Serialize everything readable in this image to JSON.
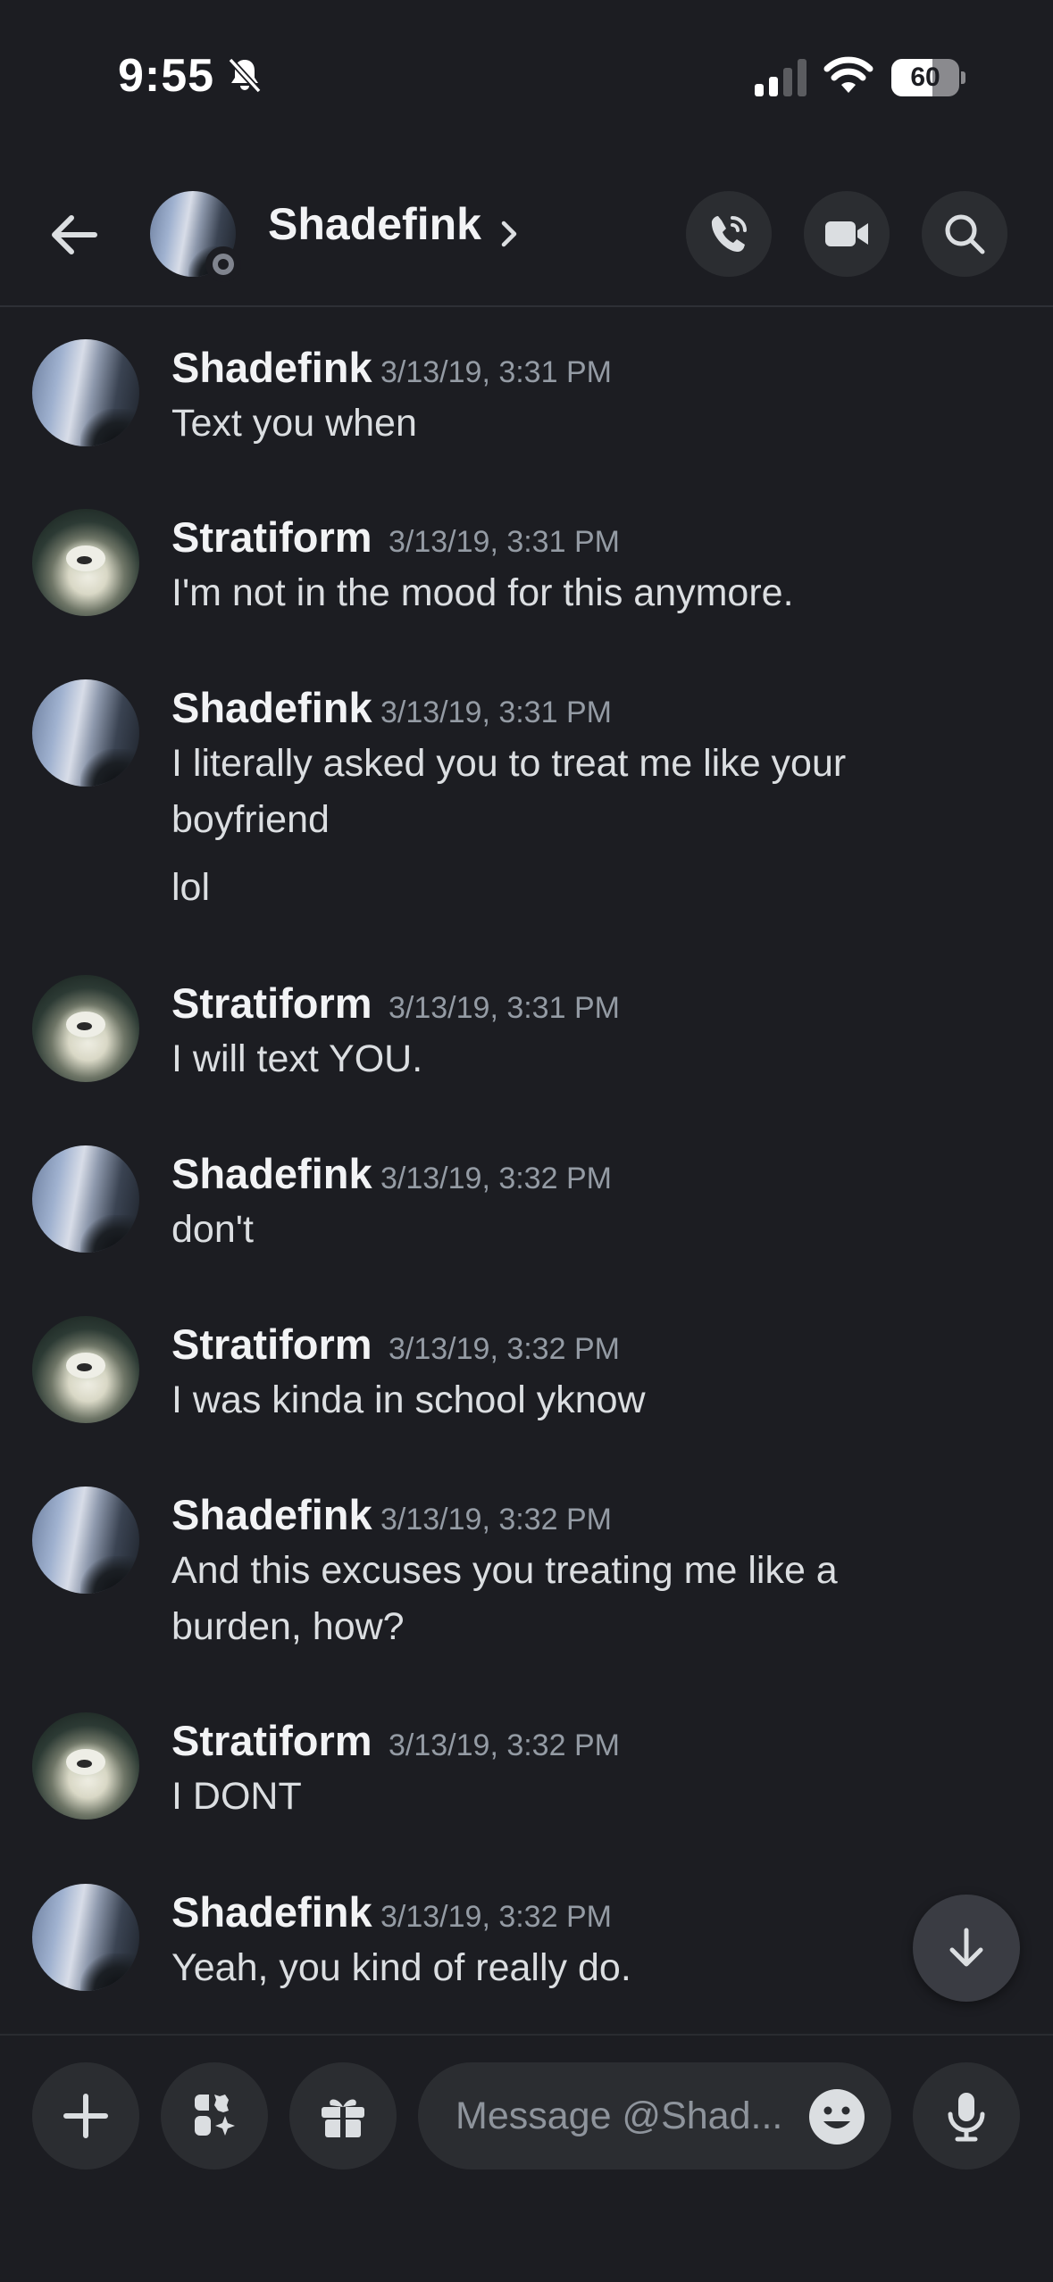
{
  "status_bar": {
    "time": "9:55",
    "battery": "60",
    "battery_level": 0.6
  },
  "header": {
    "name": "Shadefink",
    "icons": [
      "back-arrow-icon",
      "chevron-right-icon",
      "phone-call-icon",
      "video-camera-icon",
      "search-icon"
    ]
  },
  "messages": [
    {
      "author": "Shadefink",
      "timestamp": "3/13/19, 3:31 PM",
      "lines": [
        "Text you when"
      ]
    },
    {
      "author": "Stratiform",
      "timestamp": "3/13/19, 3:31 PM",
      "lines": [
        "I'm not in the mood for this anymore."
      ]
    },
    {
      "author": "Shadefink",
      "timestamp": "3/13/19, 3:31 PM",
      "lines": [
        "I literally asked you to treat me like your",
        "boyfriend",
        "lol"
      ]
    },
    {
      "author": "Stratiform",
      "timestamp": "3/13/19, 3:31 PM",
      "lines": [
        "I will text YOU."
      ]
    },
    {
      "author": "Shadefink",
      "timestamp": "3/13/19, 3:32 PM",
      "lines": [
        "don't"
      ]
    },
    {
      "author": "Stratiform",
      "timestamp": "3/13/19, 3:32 PM",
      "lines": [
        "I was kinda in school yknow"
      ]
    },
    {
      "author": "Shadefink",
      "timestamp": "3/13/19, 3:32 PM",
      "lines": [
        "And this excuses you treating me like a",
        "burden, how?"
      ]
    },
    {
      "author": "Stratiform",
      "timestamp": "3/13/19, 3:32 PM",
      "lines": [
        "I DONT"
      ]
    },
    {
      "author": "Shadefink",
      "timestamp": "3/13/19, 3:32 PM",
      "lines": [
        "Yeah, you kind of really do."
      ]
    }
  ],
  "composer": {
    "placeholder": "Message @Shad...",
    "icons": [
      "plus-icon",
      "apps-icon",
      "gift-icon",
      "emoji-icon",
      "microphone-icon"
    ]
  },
  "colors": {
    "background": "#1c1d22",
    "button_bg": "#2b2d31",
    "text": "#dbdee1",
    "muted": "#949ba4"
  }
}
